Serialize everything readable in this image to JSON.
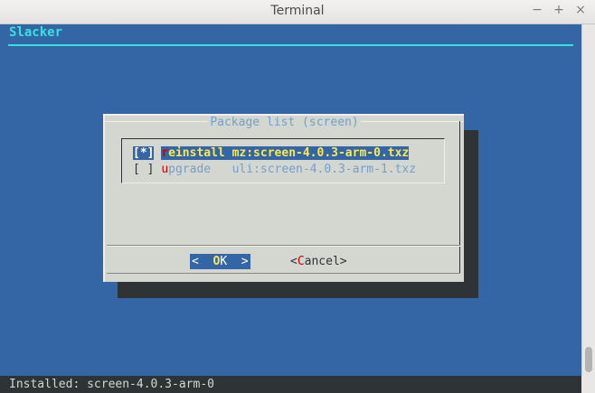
{
  "window": {
    "title": "Terminal",
    "controls": {
      "minimize": "−",
      "maximize": "+",
      "close": "×"
    }
  },
  "app": {
    "title": "Slacker"
  },
  "dialog": {
    "title": "Package list (screen)",
    "items": [
      {
        "check": "[*]",
        "hotkey": "r",
        "text": "einstall mz:screen-4.0.3-arm-0.txz",
        "selected": true
      },
      {
        "check": "[ ]",
        "hotkey": "u",
        "text": "pgrade   uli:screen-4.0.3-arm-1.txz",
        "selected": false
      }
    ],
    "ok_button": {
      "left": "<  ",
      "hotkey": "O",
      "right": "K  >"
    },
    "cancel_button": {
      "left": "<",
      "hotkey": "C",
      "right": "ancel>"
    }
  },
  "status": {
    "text": "Installed: screen-4.0.3-arm-0"
  },
  "colors": {
    "terminal_bg": "#3465a4",
    "dialog_bg": "#d3d7cf",
    "accent_cyan": "#34e2e2",
    "hotkey_red": "#cc0000",
    "selected_text": "#fce94f"
  }
}
